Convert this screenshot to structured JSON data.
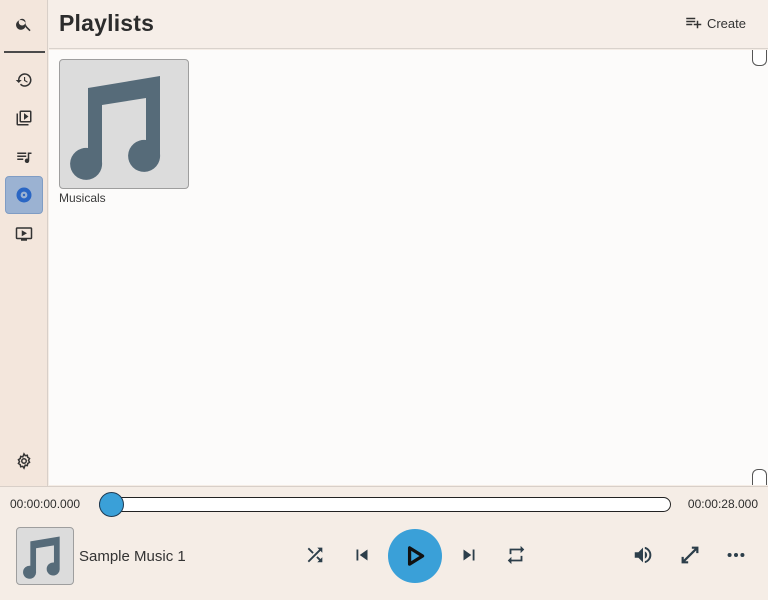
{
  "header": {
    "title": "Playlists",
    "create_label": "Create"
  },
  "sidebar": {
    "items": [
      {
        "icon": "search-icon"
      },
      {
        "icon": "history-icon"
      },
      {
        "icon": "video-library-icon"
      },
      {
        "icon": "queue-music-icon"
      },
      {
        "icon": "album-icon",
        "active": true
      },
      {
        "icon": "live-tv-icon"
      },
      {
        "icon": "gear-icon"
      }
    ]
  },
  "playlists": [
    {
      "name": "Musicals",
      "art_icon": "music-note-icon"
    }
  ],
  "player": {
    "current_time": "00:00:00.000",
    "total_time": "00:00:28.000",
    "progress": 0,
    "track_title": "Sample Music 1",
    "controls": [
      "shuffle-icon",
      "skip-previous-icon",
      "play-icon",
      "skip-next-icon",
      "repeat-icon",
      "volume-icon",
      "fullscreen-icon",
      "more-icon"
    ]
  },
  "colors": {
    "accent": "#3aa0d8",
    "active_nav": "#9bb2d2",
    "icon": "#4a6472"
  }
}
